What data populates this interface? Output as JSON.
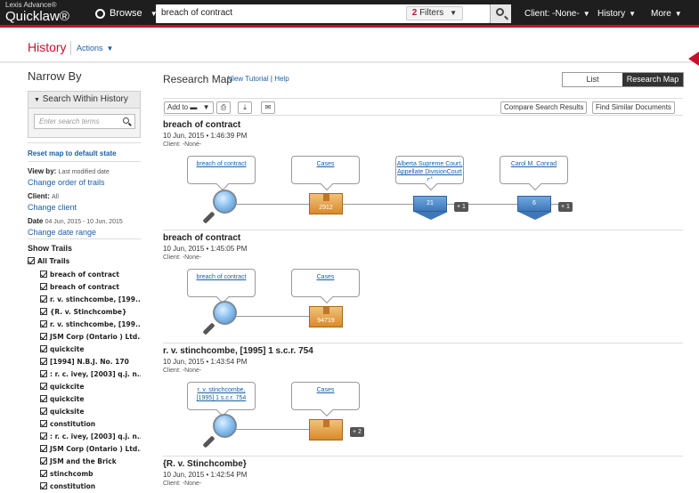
{
  "topbar": {
    "brand_line1": "Lexis Advance®",
    "brand_line2": "Quicklaw®",
    "browse_label": "Browse",
    "search_value": "breach of contract",
    "filters_count": "2",
    "filters_label": "Filters",
    "client_label": "Client: -None-",
    "history_label": "History",
    "more_label": "More"
  },
  "header": {
    "title": "History",
    "actions_label": "Actions"
  },
  "left": {
    "narrow_by": "Narrow By",
    "search_within": "Search Within History",
    "search_placeholder": "Enter search terms",
    "reset_link": "Reset map to default state",
    "view_by_label": "View by:",
    "view_by_value": "Last modified date",
    "change_order": "Change order of trails",
    "client_label": "Client:",
    "client_value": "All",
    "change_client": "Change client",
    "date_label": "Date",
    "date_value": "04 Jun, 2015 - 10 Jun, 2015",
    "change_date": "Change date range",
    "show_trails": "Show Trails",
    "all_trails": "All Trails",
    "trails": [
      "breach of contract",
      "breach of contract",
      "r. v. stinchcombe, [199...",
      "{R. v. Stinchcombe}",
      "r. v. stinchcombe, [199...",
      "JSM Corp (Ontario ) Ltd....",
      "quickcite",
      "[1994] N.B.J. No. 170",
      ": r. c. ivey, [2003] q.j. n...",
      "quickcite",
      "quickcite",
      "quicksite",
      "constitution",
      ": r. c. ivey, [2003] q.j. n...",
      "JSM Corp (Ontario ) Ltd....",
      "JSM and the Brick",
      "stinchcomb",
      "constitution"
    ]
  },
  "main": {
    "title": "Research Map",
    "view_tutorial": "View Tutorial",
    "separator": "|",
    "help": "Help",
    "list_label": "List",
    "research_map_label": "Research Map",
    "add_to": "Add to",
    "compare": "Compare Search Results",
    "find_similar": "Find Similar Documents",
    "trail_blocks": [
      {
        "title": "breach of contract",
        "date": "10 Jun, 2015 • 1:46:39 PM",
        "client": "Client: -None-",
        "nodes": [
          "breach of contract",
          "Cases",
          "Alberta Supreme Court, Appellate DivisionCourt of",
          "Carol M. Conrad"
        ],
        "box_count": "2912",
        "shield1_count": "21",
        "badge1": "+ 1",
        "shield2_count": "6",
        "badge2": "+ 1"
      },
      {
        "title": "breach of contract",
        "date": "10 Jun, 2015 • 1:45:05 PM",
        "client": "Client: -None-",
        "nodes": [
          "breach of contract",
          "Cases"
        ],
        "box_count": "94719"
      },
      {
        "title": "r. v. stinchcombe, [1995] 1 s.c.r. 754",
        "date": "10 Jun, 2015 • 1:43:54 PM",
        "client": "Client: -None-",
        "nodes": [
          "r. v. stinchcombe, [1995] 1 s.c.r. 754",
          "Cases"
        ],
        "badge1": "+ 2"
      },
      {
        "title": "{R. v. Stinchcombe}",
        "date": "10 Jun, 2015 • 1:42:54 PM",
        "client": "Client: -None-"
      }
    ]
  },
  "colors": {
    "brand_red": "#c8102e",
    "link_blue": "#1a5fa8",
    "topbar_bg": "#1e1e1e"
  }
}
